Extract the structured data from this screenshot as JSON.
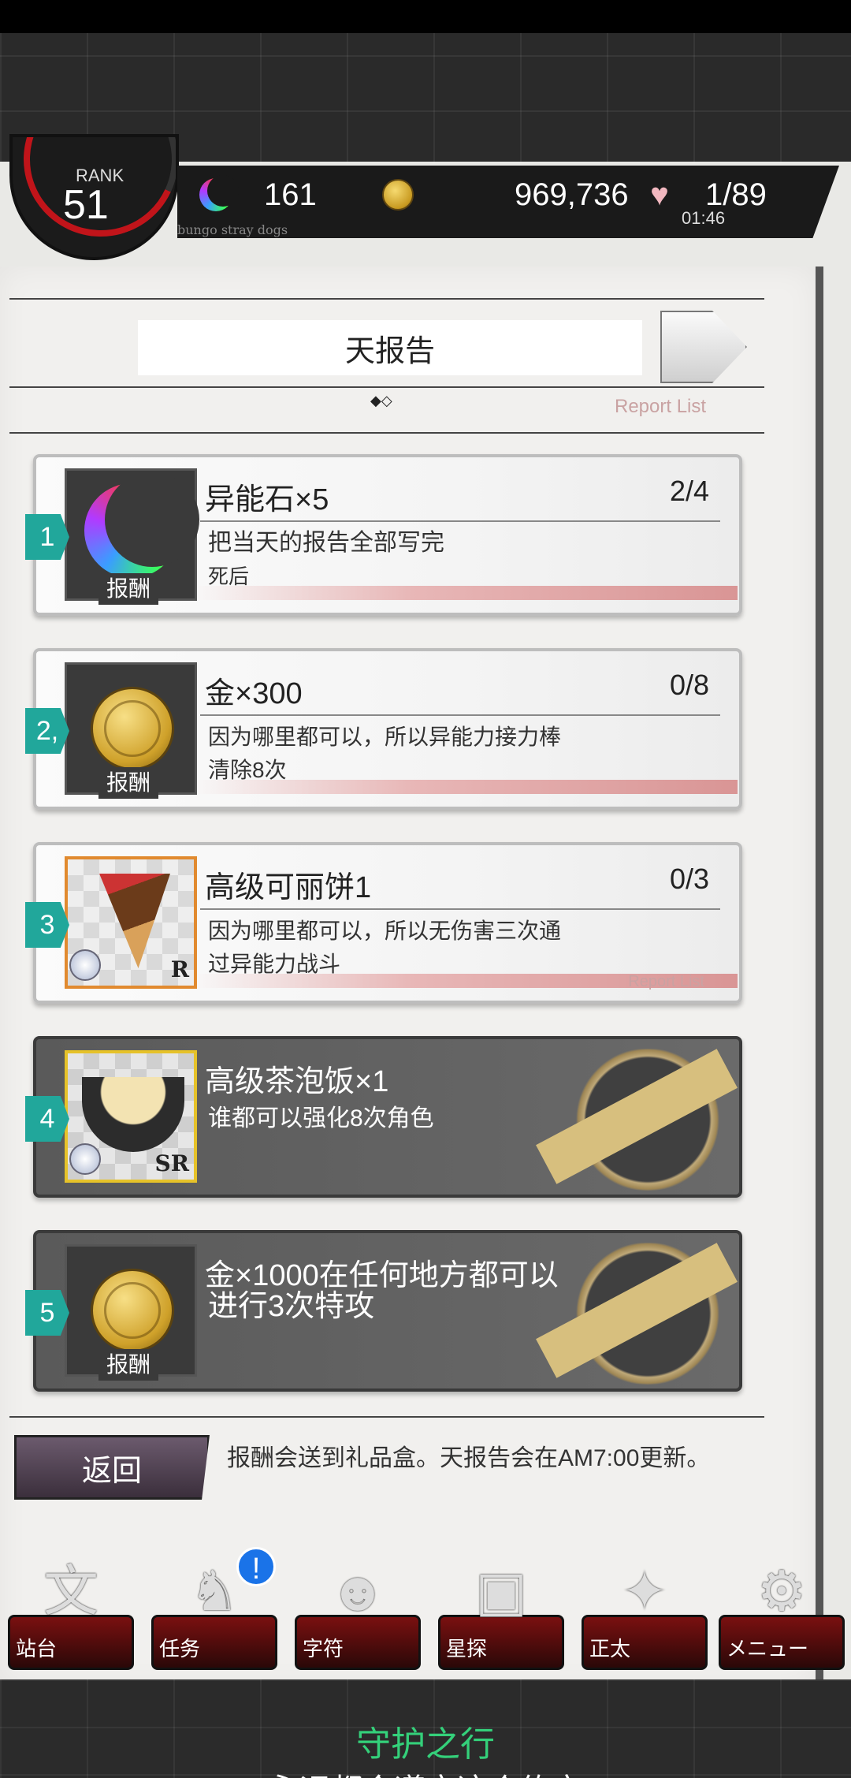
{
  "header": {
    "rank_label": "RANK",
    "rank_value": "51",
    "stones": "161",
    "gold": "969,736",
    "stamina": "1/89",
    "timer": "01:46",
    "subtitle": "bungo stray dogs"
  },
  "panel": {
    "title": "天报告",
    "pager": "◆◇",
    "report_list": "Report List"
  },
  "missions": [
    {
      "num": "1",
      "title": "异能石×5",
      "progress": "2/4",
      "desc1": "把当天的报告全部写完",
      "desc2": "死后",
      "reward_label": "报酬",
      "icon": "rainbow-moon-icon"
    },
    {
      "num": "2,",
      "title": "金×300",
      "progress": "0/8",
      "desc1": "因为哪里都可以，所以异能力接力棒",
      "desc2": "清除8次",
      "reward_label": "报酬",
      "icon": "gold-coin-icon"
    },
    {
      "num": "3",
      "title": "高级可丽饼1",
      "progress": "0/3",
      "desc1": "因为哪里都可以，所以无伤害三次通",
      "desc2": "过异能力战斗",
      "rarity": "R",
      "icon": "crepe-icon",
      "report_list": "Report List"
    },
    {
      "num": "4",
      "title": "高级茶泡饭×1",
      "progress": "",
      "desc1": "谁都可以强化8次角色",
      "desc2": "",
      "rarity": "SR",
      "icon": "ochazuke-bowl-icon"
    },
    {
      "num": "5",
      "title": "金×1000在任何地方都可以",
      "progress": "",
      "desc1": "进行3次特攻",
      "desc2": "",
      "reward_label": "报酬",
      "icon": "gold-coin-icon"
    }
  ],
  "footer_bar": {
    "back_label": "返回",
    "note": "报酬会送到礼品盒。天报告会在AM7:00更新。"
  },
  "nav": [
    {
      "label": "站台",
      "icon": "station-icon"
    },
    {
      "label": "任务",
      "icon": "tiger-icon",
      "badge": "!"
    },
    {
      "label": "字符",
      "icon": "characters-icon"
    },
    {
      "label": "星探",
      "icon": "book-icon"
    },
    {
      "label": "正太",
      "icon": "shop-cart-icon"
    },
    {
      "label": "メニュー",
      "icon": "gear-icon"
    }
  ],
  "bottom_banner": {
    "line1": "守护之行",
    "line2": "永远都会遵守这个约定"
  }
}
